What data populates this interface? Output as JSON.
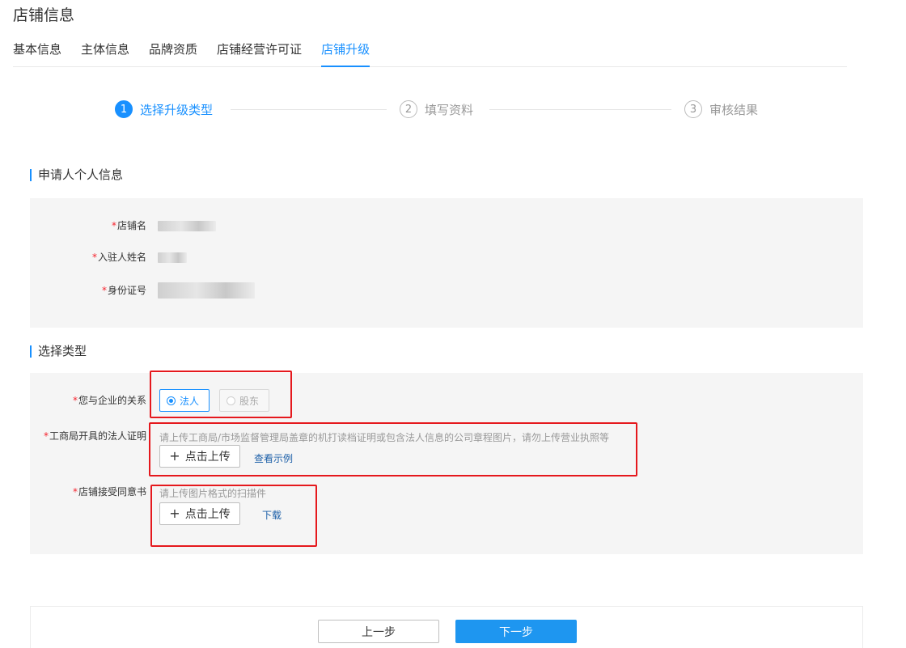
{
  "page": {
    "title": "店铺信息"
  },
  "tabs": [
    {
      "label": "基本信息"
    },
    {
      "label": "主体信息"
    },
    {
      "label": "品牌资质"
    },
    {
      "label": "店铺经营许可证"
    },
    {
      "label": "店铺升级",
      "active": true
    }
  ],
  "steps": [
    {
      "number": "1",
      "label": "选择升级类型",
      "state": "active"
    },
    {
      "number": "2",
      "label": "填写资料",
      "state": "wait"
    },
    {
      "number": "3",
      "label": "审核结果",
      "state": "wait"
    }
  ],
  "personal_info": {
    "title": "申请人个人信息",
    "fields": [
      {
        "required": "*",
        "label": "店铺名",
        "value": ""
      },
      {
        "required": "*",
        "label": "入驻人姓名",
        "value": ""
      },
      {
        "required": "*",
        "label": "身份证号",
        "value": ""
      }
    ]
  },
  "select_type": {
    "title": "选择类型",
    "relationship": {
      "required": "*",
      "label": "您与企业的关系",
      "options": [
        {
          "label": "法人",
          "checked": true
        },
        {
          "label": "股东",
          "checked": false
        }
      ]
    },
    "legal_proof": {
      "required": "*",
      "label": "工商局开具的法人证明",
      "hint": "请上传工商局/市场监督管理局盖章的机打读档证明或包含法人信息的公司章程图片，请勿上传营业执照等",
      "upload_label": "点击上传",
      "example_link": "查看示例"
    },
    "consent_letter": {
      "required": "*",
      "label": "店铺接受同意书",
      "hint": "请上传图片格式的扫描件",
      "upload_label": "点击上传",
      "download_link": "下载"
    }
  },
  "footer": {
    "prev_label": "上一步",
    "next_label": "下一步"
  },
  "colors": {
    "accent": "#1890ff",
    "required": "#f5222d",
    "highlight_box": "#e5181d",
    "panel_bg": "#f5f5f5"
  }
}
